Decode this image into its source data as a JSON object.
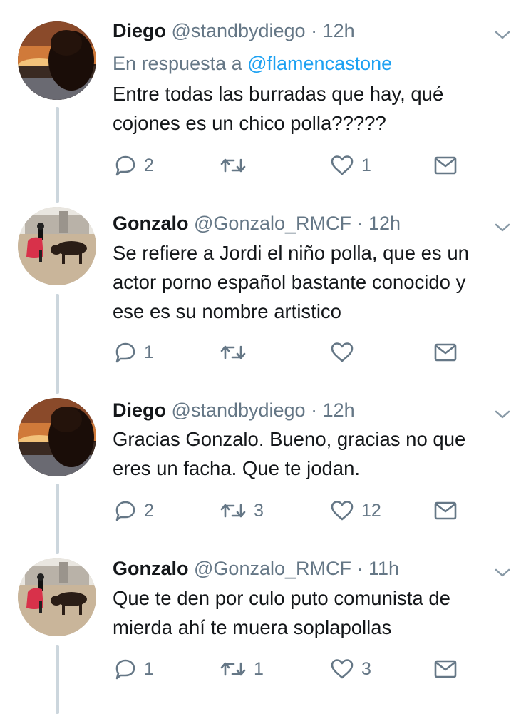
{
  "tweets": [
    {
      "name": "Diego",
      "handle": "@standbydiego",
      "time": "12h",
      "avatar": "sunset-silhouette-avatar",
      "reply_prefix": "En respuesta a ",
      "reply_mention": "@flamencastone",
      "lines": [
        "Entre todas las burradas que hay, qué",
        "cojones es un chico polla?????"
      ],
      "replies": "2",
      "retweets": "",
      "likes": "1"
    },
    {
      "name": "Gonzalo",
      "handle": "@Gonzalo_RMCF",
      "time": "12h",
      "avatar": "bullfighter-avatar",
      "lines": [
        "Se refiere a Jordi el niño polla, que es un",
        "actor porno español bastante conocido y",
        "ese es su nombre artistico"
      ],
      "replies": "1",
      "retweets": "",
      "likes": ""
    },
    {
      "name": "Diego",
      "handle": "@standbydiego",
      "time": "12h",
      "avatar": "sunset-silhouette-avatar",
      "lines": [
        "Gracias Gonzalo. Bueno, gracias no que",
        "eres un facha. Que te jodan."
      ],
      "replies": "2",
      "retweets": "3",
      "likes": "12"
    },
    {
      "name": "Gonzalo",
      "handle": "@Gonzalo_RMCF",
      "time": "11h",
      "avatar": "bullfighter-avatar",
      "lines": [
        "Que te den por culo puto comunista de",
        "mierda ahí te muera soplapollas"
      ],
      "replies": "1",
      "retweets": "1",
      "likes": "3"
    }
  ],
  "separator": " · ",
  "icons": {
    "reply": "reply-bubble-icon",
    "retweet": "retweet-icon",
    "like": "heart-icon",
    "dm": "envelope-icon",
    "more": "chevron-down-icon"
  },
  "colors": {
    "text": "#14171a",
    "muted": "#657786",
    "link": "#1da1f2",
    "thread_line": "#ccd6dd"
  }
}
